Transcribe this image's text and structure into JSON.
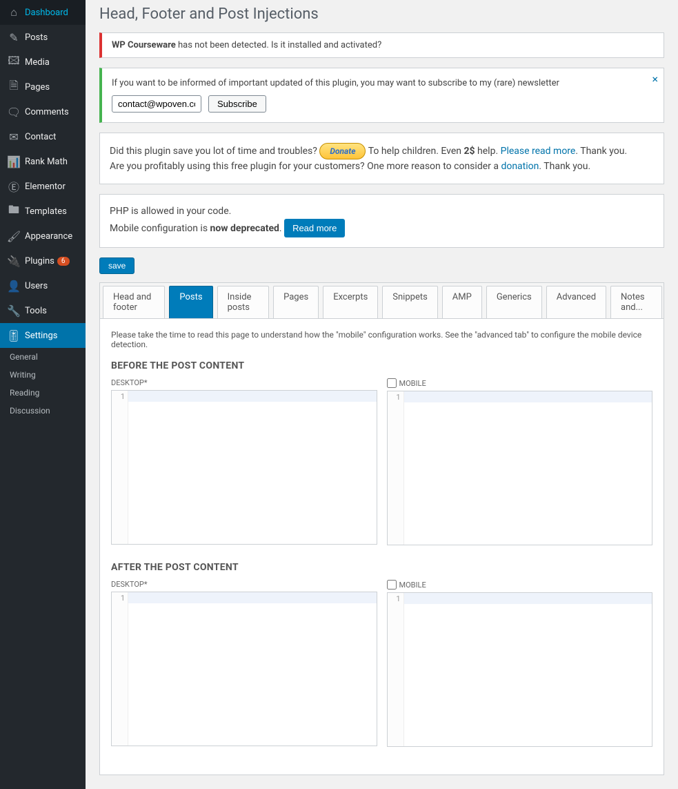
{
  "sidebar": {
    "items": [
      {
        "label": "Dashboard",
        "icon": "⌂"
      },
      {
        "label": "Posts",
        "icon": "✎"
      },
      {
        "label": "Media",
        "icon": "🖾"
      },
      {
        "label": "Pages",
        "icon": "🗎"
      },
      {
        "label": "Comments",
        "icon": "🗨"
      },
      {
        "label": "Contact",
        "icon": "✉"
      },
      {
        "label": "Rank Math",
        "icon": "📊"
      },
      {
        "label": "Elementor",
        "icon": "Ⓔ"
      },
      {
        "label": "Templates",
        "icon": "🖿"
      },
      {
        "label": "Appearance",
        "icon": "🖌"
      },
      {
        "label": "Plugins",
        "icon": "🔌",
        "badge": "6"
      },
      {
        "label": "Users",
        "icon": "👤"
      },
      {
        "label": "Tools",
        "icon": "🔧"
      },
      {
        "label": "Settings",
        "icon": "🎚",
        "active": true
      }
    ],
    "submenu": [
      "General",
      "Writing",
      "Reading",
      "Discussion"
    ]
  },
  "page": {
    "title": "Head, Footer and Post Injections"
  },
  "error_notice": {
    "strong": "WP Courseware",
    "rest": " has not been detected. Is it installed and activated?"
  },
  "newsletter": {
    "text": "If you want to be informed of important updated of this plugin, you may want to subscribe to my (rare) newsletter",
    "email": "contact@wpoven.com",
    "subscribe": "Subscribe"
  },
  "donate_panel": {
    "pre": "Did this plugin save you lot of time and troubles? ",
    "donate": "Donate",
    "mid1": " To help children. Even ",
    "twoDollar": "2$",
    "mid2": " help. ",
    "readMore": "Please read more",
    "mid3": ". Thank you.",
    "line2a": "Are you profitably using this free plugin for your customers? One more reason to consider a ",
    "donation": "donation",
    "line2b": ". Thank you."
  },
  "php_panel": {
    "line1": "PHP is allowed in your code.",
    "line2a": "Mobile configuration is ",
    "deprecated": "now deprecated",
    "line2b": ". ",
    "readMore": "Read more"
  },
  "save": "save",
  "tabs": [
    "Head and footer",
    "Posts",
    "Inside posts",
    "Pages",
    "Excerpts",
    "Snippets",
    "AMP",
    "Generics",
    "Advanced",
    "Notes and..."
  ],
  "activeTab": "Posts",
  "instr": "Please take the time to read this page to understand how the \"mobile\" configuration works. See the \"advanced tab\" to configure the mobile device detection.",
  "sections": {
    "before": "BEFORE THE POST CONTENT",
    "after": "AFTER THE POST CONTENT"
  },
  "labels": {
    "desktop": "DESKTOP*",
    "mobile": "MOBILE"
  },
  "linenum": "1"
}
